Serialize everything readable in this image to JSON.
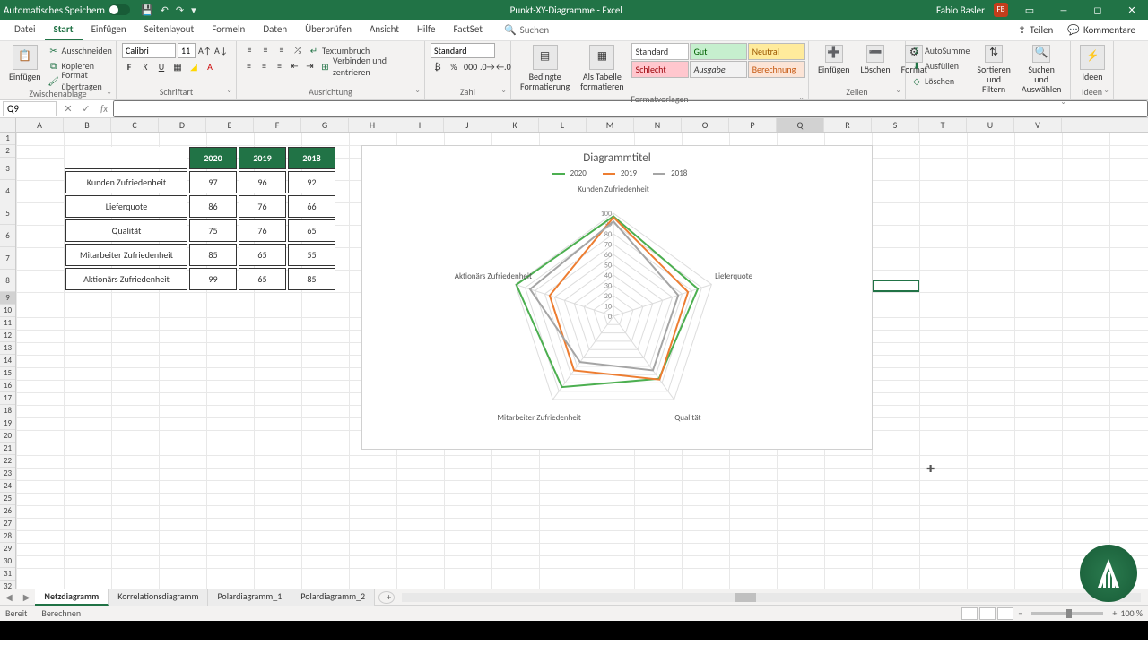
{
  "titlebar": {
    "autosave": "Automatisches Speichern",
    "docname": "Punkt-XY-Diagramme",
    "appname": "Excel",
    "username": "Fabio Basler",
    "initials": "FB"
  },
  "menu": {
    "tabs": [
      "Datei",
      "Start",
      "Einfügen",
      "Seitenlayout",
      "Formeln",
      "Daten",
      "Überprüfen",
      "Ansicht",
      "Hilfe",
      "FactSet"
    ],
    "active": 1,
    "search": "Suchen",
    "share": "Teilen",
    "comments": "Kommentare"
  },
  "ribbon": {
    "clipboard": {
      "label": "Zwischenablage",
      "paste": "Einfügen",
      "cut": "Ausschneiden",
      "copy": "Kopieren",
      "formatpainter": "Format übertragen"
    },
    "font": {
      "label": "Schriftart",
      "name": "Calibri",
      "size": "11"
    },
    "align": {
      "label": "Ausrichtung",
      "wrap": "Textumbruch",
      "merge": "Verbinden und zentrieren"
    },
    "number": {
      "label": "Zahl",
      "format": "Standard"
    },
    "styles": {
      "label": "Formatvorlagen",
      "cond": "Bedingte\nFormatierung",
      "table": "Als Tabelle\nformatieren",
      "cells": [
        "Standard",
        "Gut",
        "Neutral",
        "Schlecht",
        "Ausgabe",
        "Berechnung"
      ]
    },
    "cells": {
      "label": "Zellen",
      "insert": "Einfügen",
      "delete": "Löschen",
      "format": "Format"
    },
    "editing": {
      "label": "",
      "sum": "AutoSumme",
      "fill": "Ausfüllen",
      "clear": "Löschen",
      "sort": "Sortieren und\nFiltern",
      "find": "Suchen und\nAuswählen"
    },
    "ideas": {
      "label": "Ideen",
      "btn": "Ideen"
    }
  },
  "fbar": {
    "cell": "Q9",
    "formula": ""
  },
  "columns": [
    "A",
    "B",
    "C",
    "D",
    "E",
    "F",
    "G",
    "H",
    "I",
    "J",
    "K",
    "L",
    "M",
    "N",
    "O",
    "P",
    "Q",
    "R",
    "S",
    "T",
    "U",
    "V"
  ],
  "table": {
    "headers": [
      "2020",
      "2019",
      "2018"
    ],
    "rows": [
      {
        "label": "Kunden Zufriedenheit",
        "vals": [
          97,
          96,
          92
        ]
      },
      {
        "label": "Lieferquote",
        "vals": [
          86,
          76,
          66
        ]
      },
      {
        "label": "Qualität",
        "vals": [
          75,
          76,
          65
        ]
      },
      {
        "label": "Mitarbeiter Zufriedenheit",
        "vals": [
          85,
          65,
          55
        ]
      },
      {
        "label": "Aktionärs Zufriedenheit",
        "vals": [
          99,
          65,
          85
        ]
      }
    ]
  },
  "chart_data": {
    "type": "radar",
    "title": "Diagrammtitel",
    "categories": [
      "Kunden Zufriedenheit",
      "Lieferquote",
      "Qualität",
      "Mitarbeiter Zufriedenheit",
      "Aktionärs Zufriedenheit"
    ],
    "ticks": [
      0,
      10,
      20,
      30,
      40,
      50,
      60,
      70,
      80,
      90,
      100
    ],
    "series": [
      {
        "name": "2020",
        "color": "#4caf50",
        "values": [
          97,
          86,
          75,
          85,
          99
        ]
      },
      {
        "name": "2019",
        "color": "#ed7d31",
        "values": [
          96,
          76,
          76,
          65,
          65
        ]
      },
      {
        "name": "2018",
        "color": "#a5a5a5",
        "values": [
          92,
          66,
          65,
          55,
          85
        ]
      }
    ]
  },
  "sheets": {
    "tabs": [
      "Netzdiagramm",
      "Korrelationsdiagramm",
      "Polardiagramm_1",
      "Polardiagramm_2"
    ],
    "active": 0
  },
  "status": {
    "ready": "Bereit",
    "calc": "Berechnen",
    "zoom": "100 %"
  }
}
